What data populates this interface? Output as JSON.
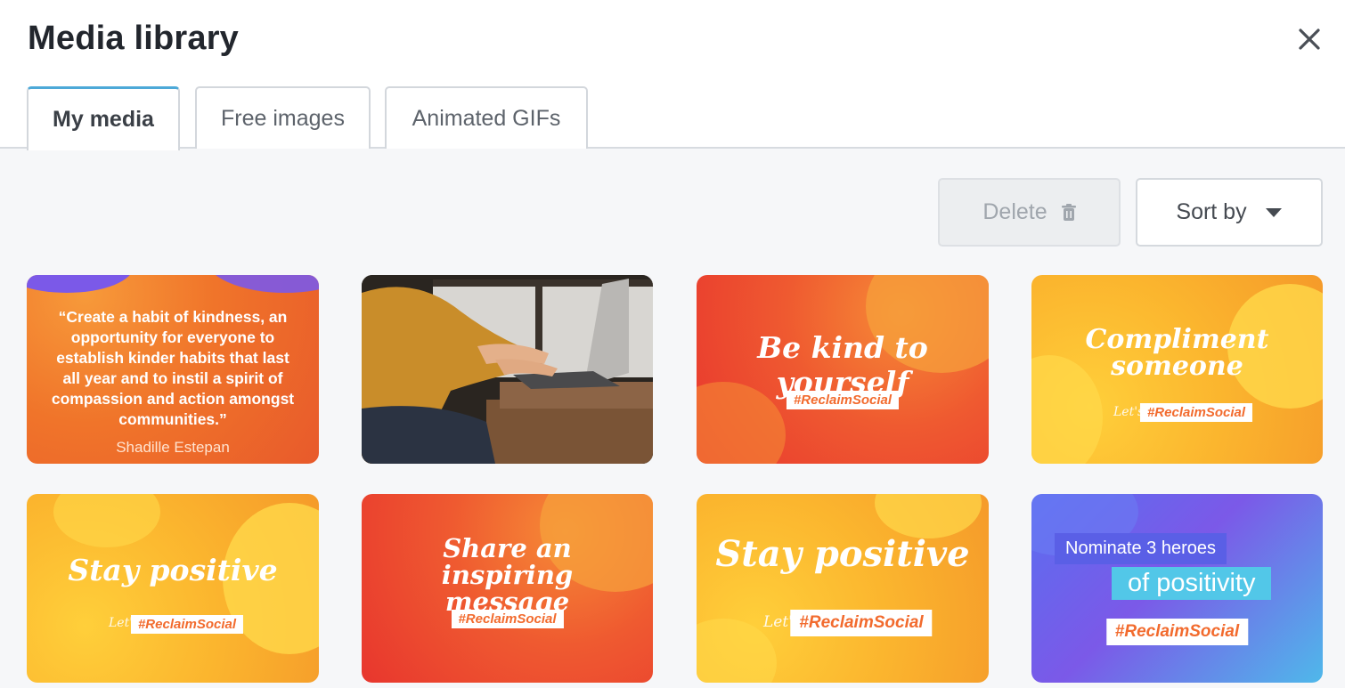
{
  "header": {
    "title": "Media library",
    "close_icon": "close-icon"
  },
  "tabs": [
    {
      "label": "My media",
      "active": true
    },
    {
      "label": "Free images",
      "active": false
    },
    {
      "label": "Animated GIFs",
      "active": false
    }
  ],
  "toolbar": {
    "delete_label": "Delete",
    "delete_icon": "trash-icon",
    "sort_label": "Sort by",
    "sort_icon": "caret-down-icon"
  },
  "media": [
    {
      "kind": "quote",
      "text": "“Create a habit of kindness, an opportunity for everyone to establish kinder habits that last all year and to instil a spirit of compassion and action amongst communities.”",
      "author": "Shadille Estepan"
    },
    {
      "kind": "photo"
    },
    {
      "kind": "graphic",
      "text": "Be kind to yourself",
      "tag": "#ReclaimSocial"
    },
    {
      "kind": "graphic",
      "text": "Compliment someone",
      "prefix": "Let's",
      "tag": "#ReclaimSocial"
    },
    {
      "kind": "graphic",
      "text": "Stay positive",
      "prefix": "Let's",
      "tag": "#ReclaimSocial"
    },
    {
      "kind": "graphic",
      "text": "Share an inspiring message",
      "tag": "#ReclaimSocial"
    },
    {
      "kind": "graphic",
      "text": "Stay positive",
      "prefix": "Let's",
      "tag": "#ReclaimSocial"
    },
    {
      "kind": "graphic",
      "text1": "Nominate 3 heroes",
      "text2": "of positivity",
      "tag": "#ReclaimSocial"
    }
  ],
  "colors": {
    "accent": "#4da9d8",
    "orange": "#f0742a",
    "yellow": "#fbb52e",
    "purple": "#7b59e8"
  }
}
